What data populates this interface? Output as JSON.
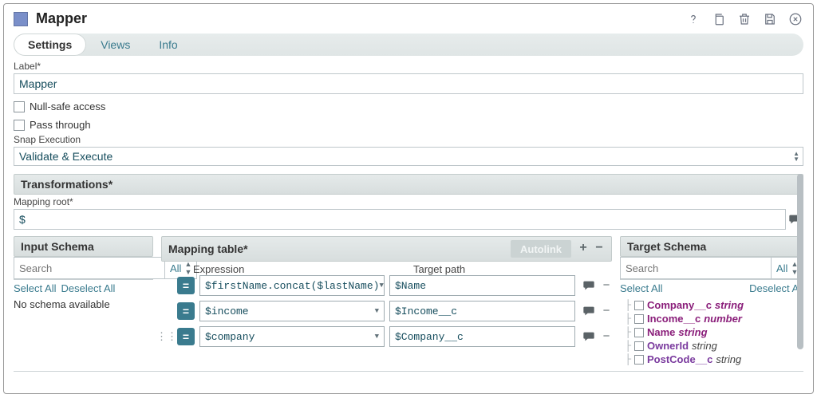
{
  "header": {
    "title": "Mapper"
  },
  "tabs": {
    "settings": "Settings",
    "views": "Views",
    "info": "Info"
  },
  "labels": {
    "label": "Label*",
    "null_safe": "Null-safe access",
    "pass_through": "Pass through",
    "snap_exec": "Snap Execution",
    "transformations": "Transformations*",
    "mapping_root": "Mapping root*",
    "input_schema": "Input Schema",
    "mapping_table": "Mapping table*",
    "autolink": "Autolink",
    "target_schema": "Target Schema",
    "expression": "Expression",
    "target_path": "Target path",
    "select_all": "Select All",
    "deselect_all": "Deselect All",
    "no_schema": "No schema available",
    "all": "All"
  },
  "fields": {
    "label_value": "Mapper",
    "snap_exec_value": "Validate & Execute",
    "mapping_root_value": "$",
    "search_placeholder": "Search"
  },
  "mapping_rows": [
    {
      "expr": "$firstName.concat($lastName)",
      "target": "$Name"
    },
    {
      "expr": "$income",
      "target": "$Income__c"
    },
    {
      "expr": "$company",
      "target": "$Company__c"
    }
  ],
  "target_tree": [
    {
      "name": "Company__c",
      "type": "string",
      "mapped": true
    },
    {
      "name": "Income__c",
      "type": "number",
      "mapped": true
    },
    {
      "name": "Name",
      "type": "string",
      "mapped": true
    },
    {
      "name": "OwnerId",
      "type": "string",
      "mapped": false
    },
    {
      "name": "PostCode__c",
      "type": "string",
      "mapped": false
    }
  ]
}
